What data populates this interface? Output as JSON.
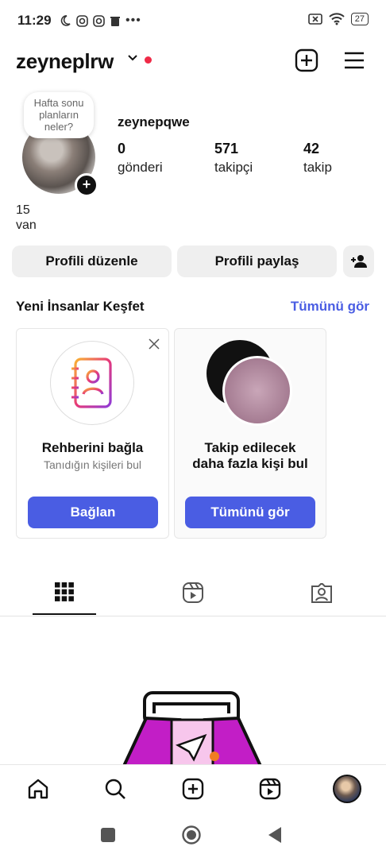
{
  "status_bar": {
    "time": "11:29",
    "battery": "27"
  },
  "header": {
    "username": "zeyneplrw"
  },
  "profile": {
    "note": "Hafta sonu planların neler?",
    "display_name": "zeynepqwe",
    "stats": [
      {
        "value": "0",
        "label": "gönderi"
      },
      {
        "value": "571",
        "label": "takipçi"
      },
      {
        "value": "42",
        "label": "takip"
      }
    ],
    "side_text_line1": "15",
    "side_text_line2": "van"
  },
  "actions": {
    "edit_profile": "Profili düzenle",
    "share_profile": "Profili paylaş"
  },
  "discover": {
    "title": "Yeni İnsanlar Keşfet",
    "see_all": "Tümünü gör",
    "cards": [
      {
        "title": "Rehberini bağla",
        "subtitle": "Tanıdığın kişileri bul",
        "button": "Bağlan"
      },
      {
        "title": "Takip edilecek daha fazla kişi bul",
        "button": "Tümünü gör"
      }
    ]
  },
  "colors": {
    "accent": "#4a5de3",
    "notification_dot": "#ef2a47",
    "button_gray": "#efefef"
  },
  "icons": {
    "header": [
      "new-post-icon",
      "menu-icon"
    ],
    "tabs": [
      "grid-icon",
      "reels-icon",
      "tagged-icon"
    ],
    "bottom_nav": [
      "home-icon",
      "search-icon",
      "create-icon",
      "reels-icon",
      "profile-avatar"
    ],
    "system_nav": [
      "recents-icon",
      "home-circle-icon",
      "back-icon"
    ]
  }
}
